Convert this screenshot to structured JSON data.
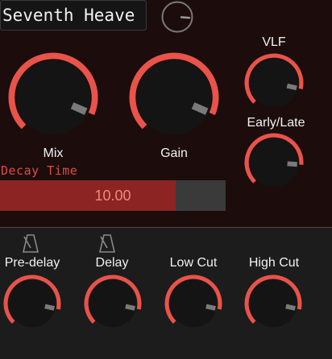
{
  "preset": {
    "name": "Seventh Heave"
  },
  "knobs": {
    "mix": {
      "label": "Mix",
      "value": 0.92
    },
    "gain": {
      "label": "Gain",
      "value": 0.92
    },
    "vlf": {
      "label": "VLF",
      "value": 0.88
    },
    "early_late": {
      "label": "Early/Late",
      "value": 0.85
    },
    "predelay": {
      "label": "Pre-delay",
      "value": 0.88
    },
    "delay": {
      "label": "Delay",
      "value": 0.88
    },
    "low_cut": {
      "label": "Low Cut",
      "value": 0.88
    },
    "high_cut": {
      "label": "High Cut",
      "value": 0.88
    },
    "preset_knob": {
      "value": 0.85
    }
  },
  "decay": {
    "label": "Decay Time",
    "value_text": "10.00",
    "fill_fraction": 0.78
  },
  "icons": {
    "predelay_sync": "metronome-icon",
    "delay_sync": "metronome-icon"
  },
  "colors": {
    "background": "#1c0c0c",
    "panel": "#1c1c1c",
    "accent": "#e8534a",
    "knob_body": "#141414",
    "pointer": "#7a7a7a",
    "label": "#f2f2f2",
    "decay_fill": "#8c2424",
    "decay_track": "#3a3a3a"
  }
}
